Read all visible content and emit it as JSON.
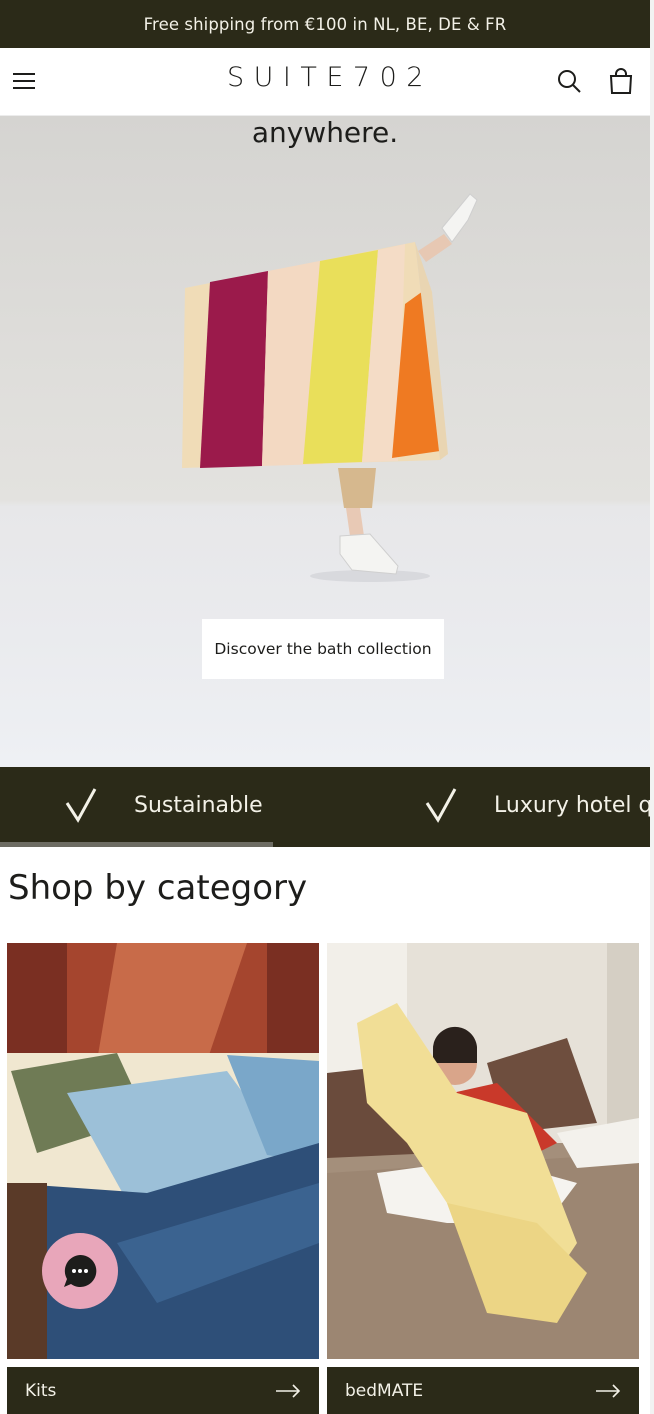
{
  "announcement": {
    "text": "Free shipping from €100 in NL, BE, DE & FR"
  },
  "header": {
    "logo": "SUITE702",
    "menu_icon": "hamburger-menu-icon",
    "search_icon": "search-icon",
    "cart_icon": "shopping-bag-icon"
  },
  "hero": {
    "text_fragment": "anywhere.",
    "cta_label": "Discover the bath collection",
    "towel_colors": [
      "#f0dcb7",
      "#9b1a4b",
      "#f2e08a",
      "#e8dc55",
      "#ef7a22"
    ]
  },
  "usp": {
    "items": [
      {
        "icon": "checkmark-icon",
        "label": "Sustainable"
      },
      {
        "icon": "checkmark-icon",
        "label": "Luxury hotel qu"
      }
    ],
    "progress": 0.42
  },
  "shop": {
    "title": "Shop by category",
    "categories": [
      {
        "label": "Kits",
        "icon": "arrow-right-icon"
      },
      {
        "label": "bedMATE",
        "icon": "arrow-right-icon"
      }
    ]
  },
  "chat": {
    "icon": "chat-bubble-icon"
  },
  "colors": {
    "dark": "#2b2a18",
    "light_text": "#f3f1e7",
    "chat_pink": "#e8a6ba"
  }
}
